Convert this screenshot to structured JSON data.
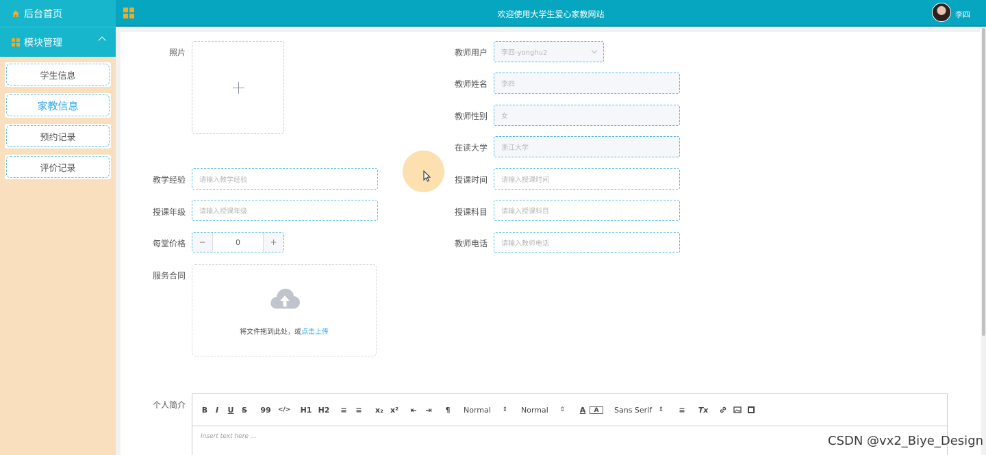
{
  "sidebar": {
    "home_label": "后台首页",
    "group_label": "模块管理",
    "items": [
      {
        "label": "学生信息"
      },
      {
        "label": "家教信息"
      },
      {
        "label": "预约记录"
      },
      {
        "label": "评价记录"
      }
    ],
    "active_item": "家教信息"
  },
  "header": {
    "title": "欢迎使用大学生爱心家教网站",
    "user_name": "李四"
  },
  "form": {
    "photo_label": "照片",
    "teaching_exp": {
      "label": "教学经验",
      "placeholder": "请输入教学经验"
    },
    "grade": {
      "label": "授课年级",
      "placeholder": "请输入授课年级"
    },
    "price": {
      "label": "每堂价格",
      "value": "0",
      "minus": "−",
      "plus": "+"
    },
    "contract": {
      "label": "服务合同",
      "drop_text": "将文件拖到此处，或",
      "drop_link": "点击上传"
    },
    "teacher_user": {
      "label": "教师用户",
      "value": "李四-yonghu2"
    },
    "teacher_name": {
      "label": "教师姓名",
      "value": "李四"
    },
    "teacher_gender": {
      "label": "教师性别",
      "value": "女"
    },
    "university": {
      "label": "在读大学",
      "value": "浙江大学"
    },
    "teaching_time": {
      "label": "授课时间",
      "placeholder": "请输入授课时间"
    },
    "subject": {
      "label": "授课科目",
      "placeholder": "请输入授课科目"
    },
    "phone": {
      "label": "教师电话",
      "placeholder": "请输入教师电话"
    },
    "intro": {
      "label": "个人简介",
      "placeholder": "Insert text here ..."
    }
  },
  "editor_toolbar": {
    "bold": "B",
    "italic": "I",
    "underline": "U",
    "strike": "S",
    "quote": "99",
    "code": "</>",
    "h1": "H1",
    "h2": "H2",
    "ordered_list": "≡",
    "bullet_list": "≡",
    "sub": "x₂",
    "sup": "x²",
    "outdent": "⇤",
    "indent": "⇥",
    "direction": "¶",
    "size_select": "Normal",
    "header_select": "Normal",
    "font_select": "Sans Serif",
    "color": "A",
    "background": "A",
    "align": "≡",
    "clean": "Tx"
  },
  "watermark": "CSDN @vx2_Biye_Design",
  "colors": {
    "sidebar_bg": "#f9dfbd",
    "header_bg": "#06a5c0",
    "accent": "#2fa8e8",
    "icon_orange": "#f7a823"
  }
}
